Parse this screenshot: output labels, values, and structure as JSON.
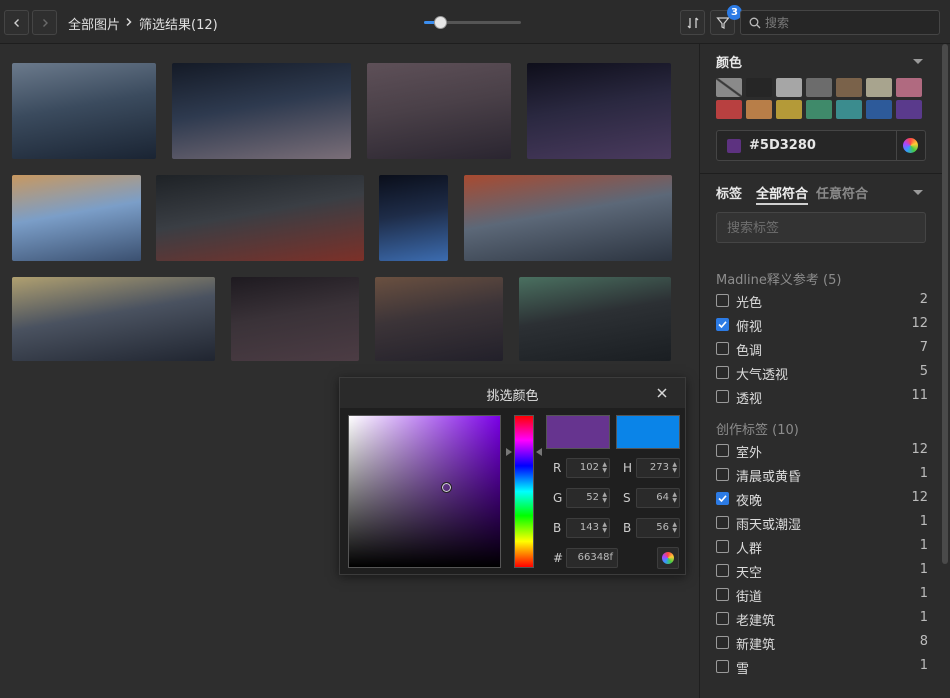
{
  "toolbar": {
    "back_icon": "chevron-left-icon",
    "forward_icon": "chevron-right-icon",
    "breadcrumb_root": "全部图片",
    "breadcrumb_sep_icon": "chevron-right-icon",
    "breadcrumb_current": "筛选结果(12)",
    "zoom_level": 0.16,
    "filter_badge": "3",
    "search_placeholder": "搜索"
  },
  "gallery": {
    "images": [
      {
        "name": "city-skyline-dusk",
        "colors": [
          "#3b4b5e",
          "#1a2433",
          "#6b7a8c"
        ]
      },
      {
        "name": "harbor-tower-sunset",
        "colors": [
          "#2e3a4f",
          "#7a6e78",
          "#141a26"
        ]
      },
      {
        "name": "hazy-city-night",
        "colors": [
          "#4a4048",
          "#2a2530",
          "#5e5058"
        ]
      },
      {
        "name": "city-lights-panorama",
        "colors": [
          "#2a2840",
          "#4a3a5e",
          "#0e0e1a"
        ]
      },
      {
        "name": "tokyo-tower-aerial",
        "colors": [
          "#7b9ec8",
          "#3b5070",
          "#c89860"
        ]
      },
      {
        "name": "temple-rooftop-lanterns",
        "colors": [
          "#3a3e44",
          "#7c3028",
          "#1e2226"
        ]
      },
      {
        "name": "neon-alley",
        "colors": [
          "#1e2c48",
          "#3c6cb0",
          "#0a0e1a"
        ]
      },
      {
        "name": "pavilion-city-view",
        "colors": [
          "#5c6878",
          "#2c3440",
          "#a84a30"
        ]
      },
      {
        "name": "bridge-road-car",
        "colors": [
          "#4a5260",
          "#202530",
          "#b0a070"
        ]
      },
      {
        "name": "misty-skyscrapers",
        "colors": [
          "#3a3238",
          "#4c3c44",
          "#1e1a20"
        ]
      },
      {
        "name": "hillside-city-night",
        "colors": [
          "#3c3438",
          "#22202a",
          "#6a5040"
        ]
      },
      {
        "name": "aerial-neon-district",
        "colors": [
          "#2c3034",
          "#1a1e22",
          "#4a7060"
        ]
      }
    ]
  },
  "color_section": {
    "title": "颜色",
    "swatches": [
      "slash",
      "#262626",
      "#a6a6a6",
      "#6c6c6c",
      "#7a624a",
      "#a8a48e",
      "#b06a80",
      "#b84040",
      "#b87e48",
      "#b49a38",
      "#3f8a6a",
      "#3b8c8e",
      "#2d5a9a",
      "#5a3a8c"
    ],
    "selected_hex": "#5D3280",
    "selected_color": "#5D3280"
  },
  "tags_section": {
    "title": "标签",
    "mode_all": "全部符合",
    "mode_any": "任意符合",
    "search_placeholder": "搜索标签",
    "groups": [
      {
        "title": "Madline释义参考 (5)",
        "tags": [
          {
            "label": "光色",
            "count": "2",
            "checked": false
          },
          {
            "label": "俯视",
            "count": "12",
            "checked": true
          },
          {
            "label": "色调",
            "count": "7",
            "checked": false
          },
          {
            "label": "大气透视",
            "count": "5",
            "checked": false
          },
          {
            "label": "透视",
            "count": "11",
            "checked": false
          }
        ]
      },
      {
        "title": "创作标签 (10)",
        "tags": [
          {
            "label": "室外",
            "count": "12",
            "checked": false
          },
          {
            "label": "清晨或黄昏",
            "count": "1",
            "checked": false
          },
          {
            "label": "夜晚",
            "count": "12",
            "checked": true
          },
          {
            "label": "雨天或潮湿",
            "count": "1",
            "checked": false
          },
          {
            "label": "人群",
            "count": "1",
            "checked": false
          },
          {
            "label": "天空",
            "count": "1",
            "checked": false
          },
          {
            "label": "街道",
            "count": "1",
            "checked": false
          },
          {
            "label": "老建筑",
            "count": "1",
            "checked": false
          },
          {
            "label": "新建筑",
            "count": "8",
            "checked": false
          },
          {
            "label": "雪",
            "count": "1",
            "checked": false
          }
        ]
      }
    ]
  },
  "color_picker": {
    "title": "挑选颜色",
    "close_icon": "close-icon",
    "new_color": "#66348F",
    "old_color": "#0A84E8",
    "r": "102",
    "g": "52",
    "b": "143",
    "h": "273",
    "s": "64",
    "v": "56",
    "hex": "66348f",
    "r_label": "R",
    "g_label": "G",
    "b_label": "B",
    "h_label": "H",
    "s_label": "S",
    "v_label": "B",
    "hash_label": "#"
  }
}
